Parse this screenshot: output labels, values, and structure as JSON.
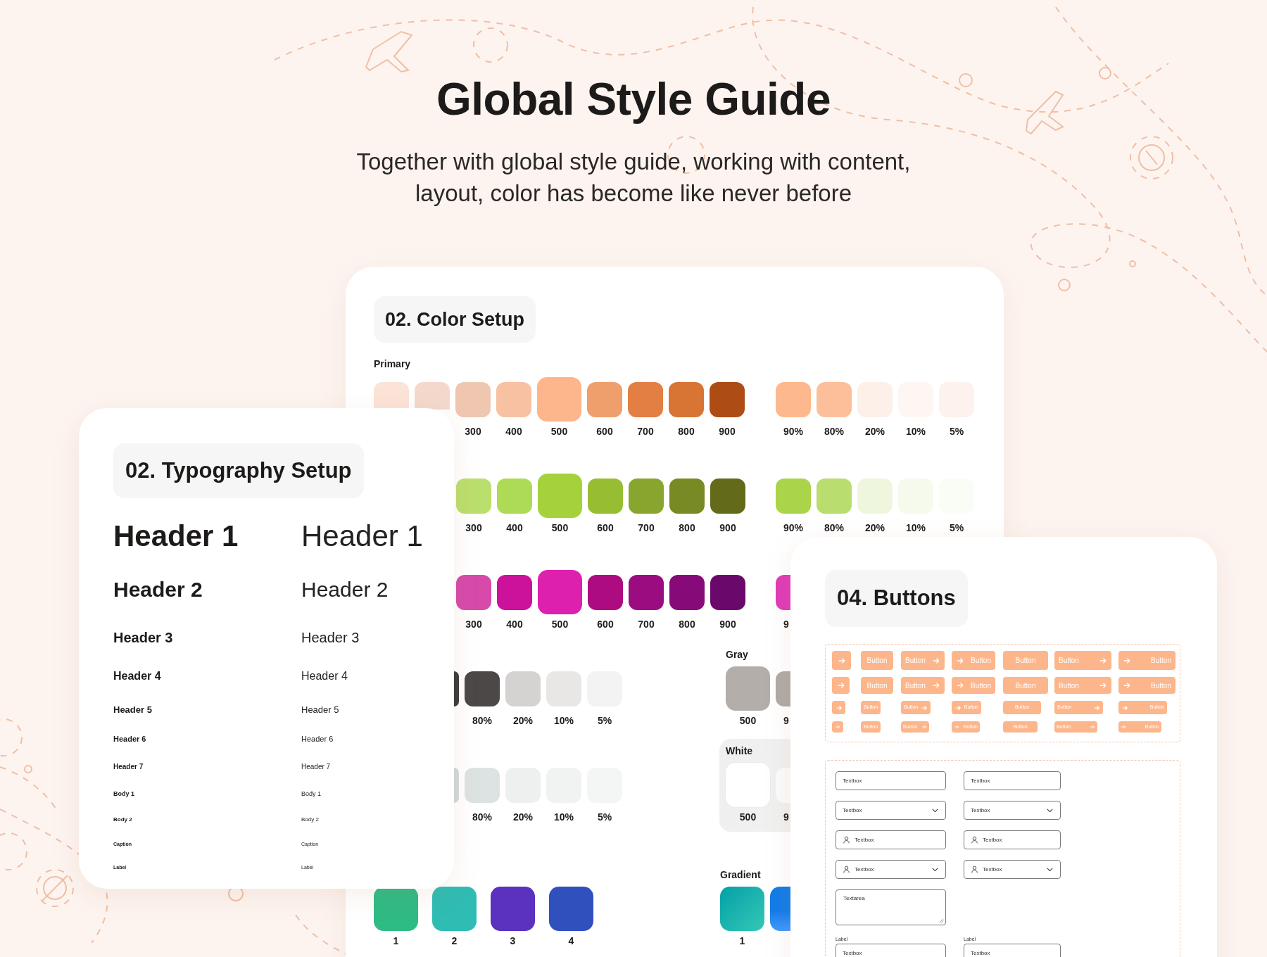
{
  "title": "Global Style Guide",
  "subtitle": "Together with global style guide, working with content,\nlayout, color has become like never before",
  "color_setup": {
    "heading": "02. Color Setup",
    "section_label": "Primary",
    "rows": [
      {
        "left": {
          "swatches": [
            {
              "color": "#fbe3d7",
              "kind": "cut_bottom"
            },
            {
              "color": "#f3d9cc",
              "kind": "cut_bottom"
            },
            {
              "color": "#efc7b0",
              "label": "300",
              "kind": "normal"
            },
            {
              "color": "#f8c1a1",
              "label": "400",
              "kind": "normal"
            },
            {
              "color": "#fdb68b",
              "label": "500",
              "kind": "large"
            },
            {
              "color": "#ee9f6c",
              "label": "600",
              "kind": "normal"
            },
            {
              "color": "#e37f43",
              "label": "700",
              "kind": "normal"
            },
            {
              "color": "#d87434",
              "label": "800",
              "kind": "normal"
            },
            {
              "color": "#ad4c14",
              "label": "900",
              "kind": "normal"
            }
          ]
        },
        "right": {
          "kind": "plain",
          "swatches": [
            {
              "color": "#fdb88e",
              "label": "90%",
              "kind": "normal"
            },
            {
              "color": "#fcbf9a",
              "label": "80%",
              "kind": "normal"
            },
            {
              "color": "#fdf0e8",
              "label": "20%",
              "kind": "normal"
            },
            {
              "color": "#fef6f2",
              "label": "10%",
              "kind": "normal"
            },
            {
              "color": "#fdf2ed",
              "label": "5%",
              "kind": "normal"
            }
          ]
        }
      },
      {
        "left": {
          "swatches": [
            {
              "color": "#bbdf6c",
              "label": "300",
              "kind": "normal"
            },
            {
              "color": "#aedb56",
              "label": "400",
              "kind": "normal"
            },
            {
              "color": "#a5d23a",
              "label": "500",
              "kind": "large"
            },
            {
              "color": "#97be32",
              "label": "600",
              "kind": "normal"
            },
            {
              "color": "#88a62d",
              "label": "700",
              "kind": "normal"
            },
            {
              "color": "#778a23",
              "label": "800",
              "kind": "normal"
            },
            {
              "color": "#636a1a",
              "label": "900",
              "kind": "normal"
            }
          ]
        },
        "right": {
          "kind": "plain",
          "swatches": [
            {
              "color": "#aad54a",
              "label": "90%",
              "kind": "normal"
            },
            {
              "color": "#b9dd6e",
              "label": "80%",
              "kind": "normal"
            },
            {
              "color": "#eef7de",
              "label": "20%",
              "kind": "normal"
            },
            {
              "color": "#f5faec",
              "label": "10%",
              "kind": "normal"
            },
            {
              "color": "#fafdf5",
              "label": "5%",
              "kind": "normal"
            }
          ]
        }
      },
      {
        "left": {
          "swatches": [
            {
              "color": "#d74aaa",
              "label": "300",
              "kind": "normal"
            },
            {
              "color": "#cc119a",
              "label": "400",
              "kind": "normal"
            },
            {
              "color": "#de20ae",
              "label": "500",
              "kind": "large"
            },
            {
              "color": "#ac0c80",
              "label": "600",
              "kind": "normal"
            },
            {
              "color": "#9a0c80",
              "label": "700",
              "kind": "normal"
            },
            {
              "color": "#870a79",
              "label": "800",
              "kind": "normal"
            },
            {
              "color": "#6b086c",
              "label": "900",
              "kind": "normal"
            }
          ]
        },
        "right": {
          "kind": "plain",
          "swatches": [
            {
              "color": "#e03cb6",
              "label": "9",
              "kind": "cut_right"
            }
          ]
        }
      },
      {
        "left": {
          "swatches": [
            {
              "color": "#3d3b3a",
              "kind": "cut_left"
            },
            {
              "color": "#4b4847",
              "label": "80%",
              "kind": "normal"
            },
            {
              "color": "#d5d3d2",
              "label": "20%",
              "kind": "normal"
            },
            {
              "color": "#e8e7e6",
              "label": "10%",
              "kind": "normal"
            },
            {
              "color": "#f3f3f3",
              "label": "5%",
              "kind": "normal"
            }
          ]
        },
        "right": {
          "kind": "plain",
          "title": "Gray",
          "swatches": [
            {
              "color": "#b3aeaa",
              "label": "500",
              "kind": "large"
            },
            {
              "color": "#b0aaa6",
              "label": "9",
              "kind": "cut_right"
            }
          ]
        }
      },
      {
        "left": {
          "swatches": [
            {
              "color": "#d3dad9",
              "kind": "cut_left"
            },
            {
              "color": "#dde3e2",
              "label": "80%",
              "kind": "normal"
            },
            {
              "color": "#edf0ef",
              "label": "20%",
              "kind": "normal"
            },
            {
              "color": "#f1f3f3",
              "label": "10%",
              "kind": "normal"
            },
            {
              "color": "#f4f5f5",
              "label": "5%",
              "kind": "normal"
            }
          ]
        },
        "right": {
          "kind": "panel",
          "title": "White",
          "swatches": [
            {
              "color": "#ffffff",
              "label": "500",
              "kind": "large"
            },
            {
              "color": "#fbfbfb",
              "label": "9",
              "kind": "cut_right"
            }
          ]
        }
      },
      {
        "left": {
          "swatches": [
            {
              "color": "#2fbb84",
              "label": "1",
              "kind": "large"
            },
            {
              "color": "#2fbcb3",
              "label": "2",
              "kind": "large"
            },
            {
              "color": "#5b31c0",
              "label": "3",
              "kind": "large"
            },
            {
              "color": "#3050bd",
              "label": "4",
              "kind": "large"
            }
          ]
        },
        "right": {
          "kind": "plain",
          "title": "Gradient",
          "swatches": [
            {
              "color": "#03a0a6",
              "label": "1",
              "kind": "gradient"
            },
            {
              "color": "#137ce8",
              "kind": "gradient_cut_right"
            }
          ]
        }
      }
    ]
  },
  "typography": {
    "heading": "02. Typography Setup",
    "rows": [
      {
        "bold": "Header 1",
        "regular": "Header 1"
      },
      {
        "bold": "Header 2",
        "regular": "Header 2"
      },
      {
        "bold": "Header 3",
        "regular": "Header 3"
      },
      {
        "bold": "Header 4",
        "regular": "Header 4"
      },
      {
        "bold": "Header 5",
        "regular": "Header 5"
      },
      {
        "bold": "Header 6",
        "regular": "Header 6"
      },
      {
        "bold": "Header 7",
        "regular": "Header 7"
      },
      {
        "bold": "Body 1",
        "regular": "Body 1"
      },
      {
        "bold": "Body 2",
        "regular": "Body 2"
      },
      {
        "bold": "Caption",
        "regular": "Caption"
      },
      {
        "bold": "Label",
        "regular": "Label"
      }
    ]
  },
  "buttons": {
    "heading": "04. Buttons",
    "button_rows": [
      {
        "buttons": [
          {
            "kind": "icon"
          },
          {
            "kind": "text",
            "label": "Button"
          },
          {
            "kind": "text_arrow",
            "label": "Button"
          },
          {
            "kind": "arrow_text",
            "label": "Button"
          },
          {
            "kind": "text",
            "label": "Button"
          },
          {
            "kind": "text_arrow",
            "label": "Button"
          },
          {
            "kind": "arrow_text",
            "label": "Button"
          }
        ]
      },
      {
        "buttons": [
          {
            "kind": "icon"
          },
          {
            "kind": "text",
            "label": "Button"
          },
          {
            "kind": "text_arrow",
            "label": "Button"
          },
          {
            "kind": "arrow_text",
            "label": "Button"
          },
          {
            "kind": "text",
            "label": "Button"
          },
          {
            "kind": "text_arrow",
            "label": "Button"
          },
          {
            "kind": "arrow_text",
            "label": "Button"
          }
        ]
      },
      {
        "buttons": [
          {
            "kind": "icon"
          },
          {
            "kind": "text",
            "label": "Button"
          },
          {
            "kind": "text_arrow",
            "label": "Button"
          },
          {
            "kind": "arrow_text",
            "label": "Button"
          },
          {
            "kind": "text",
            "label": "Button"
          },
          {
            "kind": "text_arrow",
            "label": "Button"
          },
          {
            "kind": "arrow_text",
            "label": "Button"
          }
        ]
      },
      {
        "buttons": [
          {
            "kind": "icon"
          },
          {
            "kind": "text",
            "label": "Button"
          },
          {
            "kind": "text_arrow",
            "label": "Button"
          },
          {
            "kind": "arrow_text",
            "label": "Button"
          },
          {
            "kind": "text",
            "label": "Button"
          },
          {
            "kind": "text_arrow",
            "label": "Button"
          },
          {
            "kind": "arrow_text",
            "label": "Button"
          }
        ]
      }
    ],
    "field_rows": [
      {
        "fields": [
          {
            "kind": "text",
            "value": "Textbox"
          },
          {
            "kind": "text",
            "value": "Textbox"
          }
        ]
      },
      {
        "fields": [
          {
            "kind": "select",
            "value": "Textbox"
          },
          {
            "kind": "select",
            "value": "Textbox"
          }
        ]
      },
      {
        "fields": [
          {
            "kind": "user",
            "value": "Textbox"
          },
          {
            "kind": "user",
            "value": "Textbox"
          }
        ]
      },
      {
        "fields": [
          {
            "kind": "user_select",
            "value": "Textbox"
          },
          {
            "kind": "user_select",
            "value": "Textbox"
          }
        ]
      },
      {
        "fields": [
          {
            "kind": "textarea",
            "value": "Textarea"
          }
        ]
      },
      {
        "fields": [
          {
            "kind": "labeled",
            "label": "Label",
            "value": "Textbox"
          },
          {
            "kind": "labeled",
            "label": "Label",
            "value": "Textbox"
          }
        ]
      }
    ]
  }
}
